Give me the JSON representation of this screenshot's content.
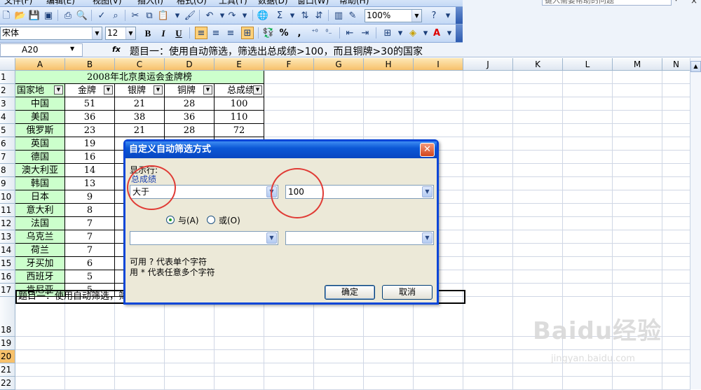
{
  "menubar": {
    "items": [
      "文件(F)",
      "编辑(E)",
      "视图(V)",
      "插入(I)",
      "格式(O)",
      "工具(T)",
      "数据(D)",
      "窗口(W)",
      "帮助(H)"
    ],
    "help_placeholder": "键入需要帮助的问题",
    "close_glyph": "×"
  },
  "std_toolbar": {
    "zoom": "100%"
  },
  "fmt_toolbar": {
    "font_name": "宋体",
    "font_size": "12",
    "bold": "B",
    "italic": "I",
    "underline": "U",
    "percent": "%",
    "comma": ","
  },
  "formula_bar": {
    "name_box": "A20",
    "fx": "fx",
    "content": "题目一：使用自动筛选，筛选出总成绩>100，而且铜牌>30的国家"
  },
  "columns": [
    "A",
    "B",
    "C",
    "D",
    "E",
    "F",
    "G",
    "H",
    "I",
    "J",
    "K",
    "L",
    "M",
    "N"
  ],
  "rows": [
    "1",
    "2",
    "3",
    "4",
    "5",
    "6",
    "7",
    "8",
    "9",
    "10",
    "11",
    "12",
    "13",
    "14",
    "15",
    "16",
    "17",
    "18",
    "19",
    "20",
    "21",
    "22"
  ],
  "table": {
    "title": "2008年北京奥运会金牌榜",
    "headers": [
      "国家地",
      "金牌",
      "银牌",
      "铜牌",
      "总成绩"
    ],
    "rows": [
      [
        "中国",
        "51",
        "21",
        "28",
        "100"
      ],
      [
        "美国",
        "36",
        "38",
        "36",
        "110"
      ],
      [
        "俄罗斯",
        "23",
        "21",
        "28",
        "72"
      ],
      [
        "英国",
        "19",
        "",
        "",
        ""
      ],
      [
        "德国",
        "16",
        "",
        "",
        ""
      ],
      [
        "澳大利亚",
        "14",
        "",
        "",
        ""
      ],
      [
        "韩国",
        "13",
        "",
        "",
        ""
      ],
      [
        "日本",
        "9",
        "",
        "",
        ""
      ],
      [
        "意大利",
        "8",
        "",
        "",
        ""
      ],
      [
        "法国",
        "7",
        "",
        "",
        ""
      ],
      [
        "乌克兰",
        "7",
        "",
        "",
        ""
      ],
      [
        "荷兰",
        "7",
        "",
        "",
        ""
      ],
      [
        "牙买加",
        "6",
        "",
        "",
        ""
      ],
      [
        "西班牙",
        "5",
        "",
        "",
        ""
      ],
      [
        "肯尼亚",
        "5",
        "",
        "",
        ""
      ]
    ]
  },
  "a20_text": "题目一：使用自动筛选，筛选出总成绩>100，而且铜牌>30的国家",
  "dialog": {
    "title": "自定义自动筛选方式",
    "show_rows_label": "显示行:",
    "field_label": "总成绩",
    "operator1": "大于",
    "value1": "100",
    "and_label": "与(A)",
    "or_label": "或(O)",
    "operator2": "",
    "value2": "",
    "hint1": "可用 ? 代表单个字符",
    "hint2": "用 * 代表任意多个字符",
    "ok_label": "确定",
    "cancel_label": "取消",
    "close_glyph": "✕"
  },
  "watermark": {
    "brand": "Baidu经验",
    "url": "jingyan.baidu.com"
  }
}
